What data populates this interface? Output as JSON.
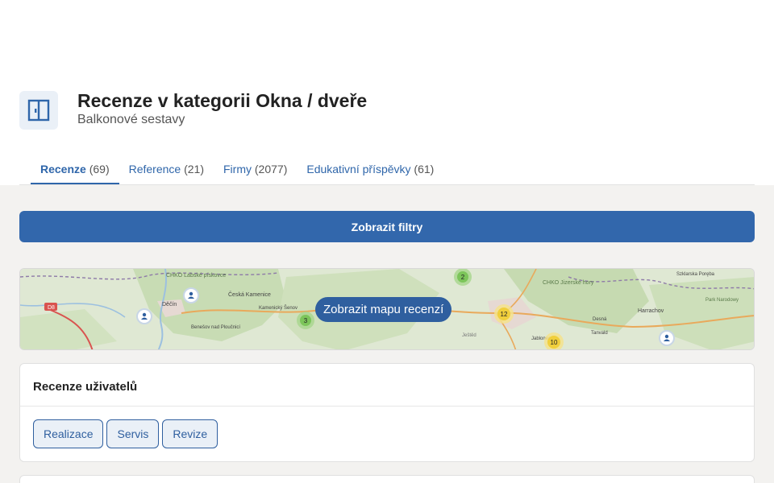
{
  "header": {
    "title": "Recenze v kategorii Okna / dveře",
    "subtitle": "Balkonové sestavy",
    "icon": "window-door-icon"
  },
  "tabs": [
    {
      "label": "Recenze",
      "count": "(69)",
      "active": true
    },
    {
      "label": "Reference",
      "count": "(21)"
    },
    {
      "label": "Firmy",
      "count": "(2077)"
    },
    {
      "label": "Edukativní příspěvky",
      "count": "(61)"
    }
  ],
  "filters": {
    "button_label": "Zobrazit filtry"
  },
  "map": {
    "button_label": "Zobrazit mapu recenzí",
    "places": [
      "CHKO Labské pískovce",
      "Děčín",
      "Česká Kamenice",
      "Kamenický Šenov",
      "Benešov nad Ploučnicí",
      "CHKO Jizerské hory",
      "Harrachov",
      "Desná",
      "Tanvald",
      "Jablonec",
      "Ještěd",
      "Park Narodowy",
      "Szklarska Poręba",
      "D8"
    ],
    "clusters": [
      "2",
      "3",
      "12",
      "10"
    ]
  },
  "reviews_card": {
    "title": "Recenze uživatelů",
    "chips": [
      "Realizace",
      "Servis",
      "Revize"
    ]
  }
}
